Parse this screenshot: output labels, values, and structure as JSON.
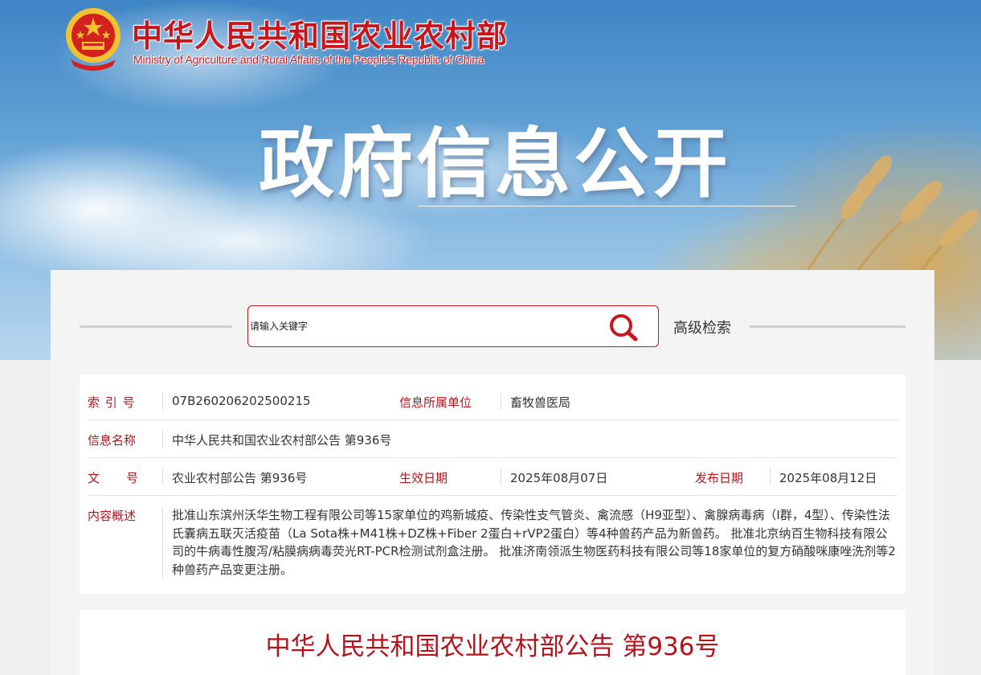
{
  "header": {
    "ministry_cn": "中华人民共和国农业农村部",
    "ministry_en": "Ministry of Agriculture and Rural Affairs of the People's Republic of China",
    "hero_title": "政府信息公开",
    "logo_icon": "national-emblem-icon"
  },
  "search": {
    "placeholder": "请输入关键字",
    "button_icon": "search-icon",
    "advanced_label": "高级检索"
  },
  "meta": {
    "index_label": "索 引 号",
    "index_value": "07B260206202500215",
    "unit_label": "信息所属单位",
    "unit_value": "畜牧兽医局",
    "name_label": "信息名称",
    "name_value": "中华人民共和国农业农村部公告 第936号",
    "doc_label_1": "文",
    "doc_label_2": "号",
    "doc_value": "农业农村部公告 第936号",
    "effective_label": "生效日期",
    "effective_value": "2025年08月07日",
    "publish_label": "发布日期",
    "publish_value": "2025年08月12日",
    "summary_label": "内容概述",
    "summary_value": "批准山东滨州沃华生物工程有限公司等15家单位的鸡新城疫、传染性支气管炎、禽流感（H9亚型）、禽腺病毒病（I群，4型）、传染性法氏囊病五联灭活疫苗（La Sota株+M41株+DZ株+Fiber 2蛋白+rVP2蛋白）等4种兽药产品为新兽药。 批准北京纳百生物科技有限公司的牛病毒性腹泻/粘膜病病毒荧光RT-PCR检测试剂盒注册。 批准济南领派生物医药科技有限公司等18家单位的复方硝酸咪康唑洗剂等2种兽药产品变更注册。"
  },
  "article": {
    "title": "中华人民共和国农业农村部公告 第936号"
  },
  "colors": {
    "accent_red": "#c8161d",
    "label_red": "#b3141b"
  }
}
